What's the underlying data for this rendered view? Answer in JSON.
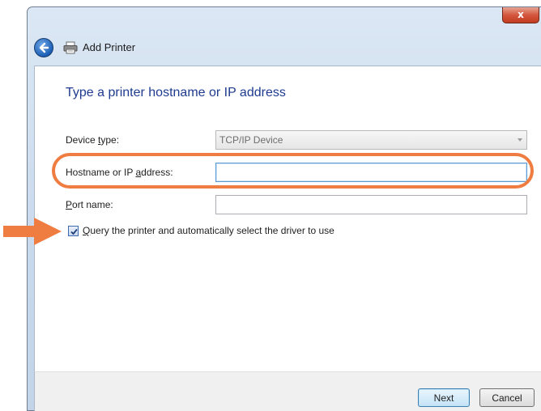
{
  "window": {
    "title": "Add Printer",
    "close_glyph": "x"
  },
  "page": {
    "heading": "Type a printer hostname or IP address"
  },
  "form": {
    "device_type": {
      "label_pre": "Device ",
      "label_accel": "t",
      "label_post": "ype:",
      "value": "TCP/IP Device"
    },
    "hostname": {
      "label_pre": "Hostname or IP ",
      "label_accel": "a",
      "label_post": "ddress:",
      "value": ""
    },
    "port_name": {
      "label_pre": "",
      "label_accel": "P",
      "label_post": "ort name:",
      "value": ""
    },
    "query_checkbox": {
      "checked": true,
      "label_pre": "",
      "label_accel": "Q",
      "label_post": "uery the printer and automatically select the driver to use"
    }
  },
  "buttons": {
    "next": "Next",
    "cancel": "Cancel"
  },
  "icons": {
    "back": "back-arrow-icon",
    "printer": "printer-icon",
    "close": "close-icon",
    "dropdown": "chevron-down-icon"
  },
  "colors": {
    "annotation": "#ef7d42",
    "heading": "#1e3b8f",
    "close_button": "#c23b20"
  }
}
